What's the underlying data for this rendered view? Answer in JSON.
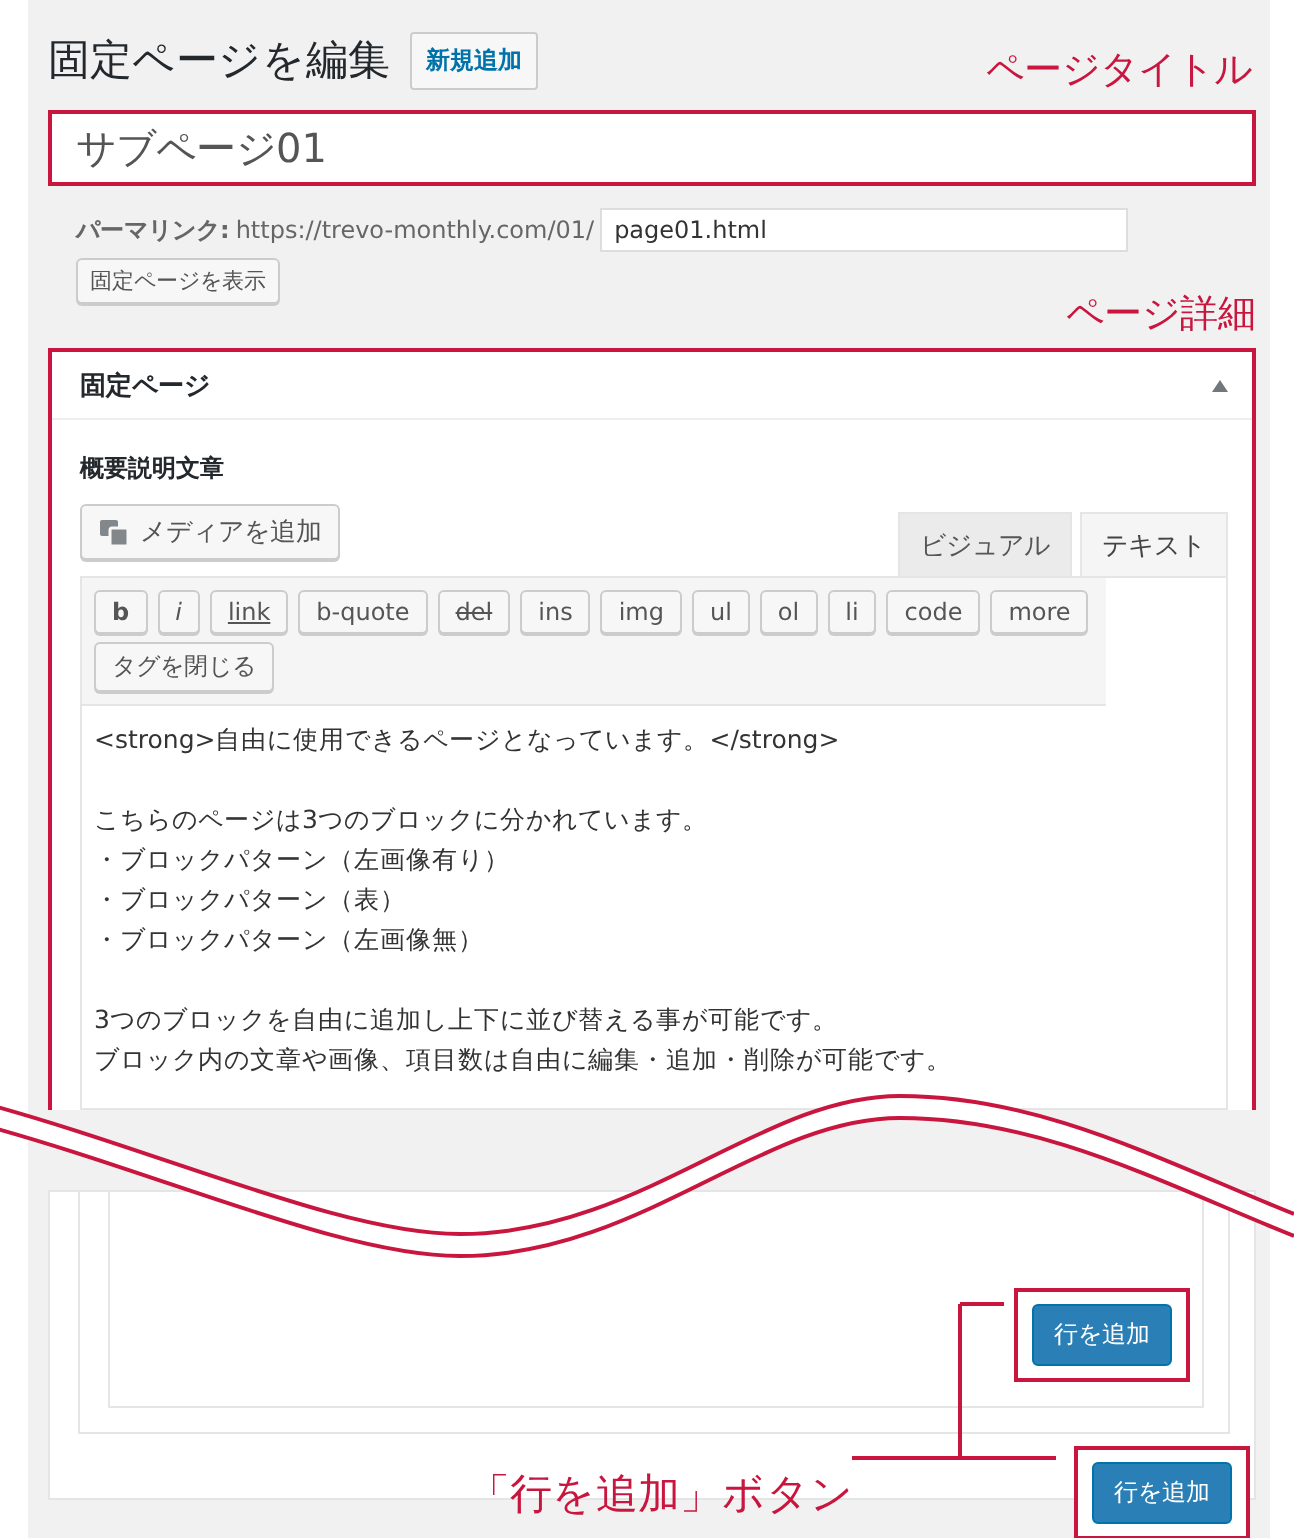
{
  "header": {
    "title": "固定ページを編集",
    "add_new_button": "新規追加"
  },
  "annotations": {
    "title_label": "ページタイトル",
    "details_label": "ページ詳細",
    "button_label": "「行を追加」ボタン"
  },
  "title_field": {
    "value": "サブページ01"
  },
  "permalink": {
    "label": "パーマリンク:",
    "base_url": "https://trevo-monthly.com/01/",
    "slug": "page01.html",
    "view_button": "固定ページを表示"
  },
  "postbox": {
    "title": "固定ページ",
    "expanded": true,
    "field_label": "概要説明文章",
    "media_button": "メディアを追加",
    "editor_tabs": [
      {
        "label": "ビジュアル",
        "selected": false
      },
      {
        "label": "テキスト",
        "selected": true
      }
    ],
    "quicktags": [
      {
        "label": "b",
        "kind": "bold"
      },
      {
        "label": "i",
        "kind": "italic"
      },
      {
        "label": "link",
        "kind": "underline"
      },
      {
        "label": "b-quote",
        "kind": "plain"
      },
      {
        "label": "del",
        "kind": "strike"
      },
      {
        "label": "ins",
        "kind": "plain"
      },
      {
        "label": "img",
        "kind": "plain"
      },
      {
        "label": "ul",
        "kind": "plain"
      },
      {
        "label": "ol",
        "kind": "plain"
      },
      {
        "label": "li",
        "kind": "plain"
      },
      {
        "label": "code",
        "kind": "plain"
      },
      {
        "label": "more",
        "kind": "plain"
      },
      {
        "label": "タグを閉じる",
        "kind": "plain"
      }
    ],
    "content_paragraphs": [
      [
        "<strong>自由に使用できるページとなっています。</strong>"
      ],
      [
        "こちらのページは3つのブロックに分かれています。",
        "・ブロックパターン（左画像有り）",
        "・ブロックパターン（表）",
        "・ブロックパターン（左画像無）"
      ],
      [
        "3つのブロックを自由に追加し上下に並び替える事が可能です。",
        "ブロック内の文章や画像、項目数は自由に編集・追加・削除が可能です。"
      ]
    ],
    "add_row_buttons": [
      "行を追加",
      "行を追加"
    ]
  }
}
